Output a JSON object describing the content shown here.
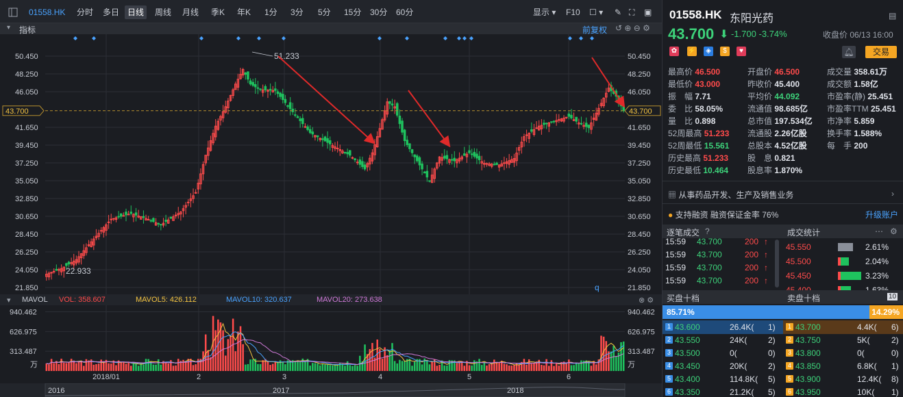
{
  "toolbar": {
    "code": "01558.HK",
    "periods": [
      "分时",
      "多日",
      "日线",
      "周线",
      "月线",
      "季K",
      "年K",
      "1分",
      "3分",
      "5分",
      "15分",
      "30分",
      "60分"
    ],
    "active_period": "日线",
    "display_label": "显示",
    "f10_label": "F10"
  },
  "indicator_bar": {
    "label": "指标",
    "adjust_label": "前复权"
  },
  "chart_data": {
    "type": "candlestick",
    "y_axis_ticks": [
      "50.450",
      "48.250",
      "46.050",
      "43.700",
      "41.650",
      "39.450",
      "37.250",
      "35.050",
      "32.850",
      "30.650",
      "28.450",
      "26.250",
      "24.050",
      "21.850"
    ],
    "ylim": [
      21.85,
      50.45
    ],
    "current_price_label": "43.700",
    "annotations": {
      "high": "51.233",
      "low": "22.933",
      "marker": "q"
    },
    "x_ticks": [
      "2018/01",
      "2",
      "3",
      "4",
      "5",
      "2018",
      "6"
    ],
    "nav_ticks": [
      "2016",
      "2017",
      "2018"
    ],
    "volume": {
      "title": "MAVOL",
      "vol_label": "VOL: 358.607",
      "ma5_label": "MAVOL5: 426.112",
      "ma10_label": "MAVOL10: 320.637",
      "ma20_label": "MAVOL20: 273.638",
      "y_ticks": [
        "940.462",
        "626.975",
        "313.487",
        "万"
      ],
      "ylim": [
        0,
        1000
      ]
    },
    "colors": {
      "up": "#ff4b4b",
      "down": "#1fc25e",
      "bg": "#1b1d22",
      "grid": "#2c2f36",
      "price_line": "#b8902e",
      "ma5": "#f5c542",
      "ma10": "#4aa3ff",
      "ma20": "#d07ad9"
    }
  },
  "quote": {
    "code": "01558.HK",
    "name": "东阳光药",
    "price": "43.700",
    "arrow": "⬇",
    "change": "-1.700",
    "change_pct": "-3.74%",
    "close_time": "收盘价 06/13 16:00",
    "trade_label": "交易"
  },
  "stats": [
    [
      {
        "k": "最高价",
        "v": "46.500",
        "c": "red"
      },
      {
        "k": "开盘价",
        "v": "46.500",
        "c": "red"
      },
      {
        "k": "成交量",
        "v": "358.61万",
        "c": ""
      }
    ],
    [
      {
        "k": "最低价",
        "v": "43.000",
        "c": "red"
      },
      {
        "k": "昨收价",
        "v": "45.400",
        "c": ""
      },
      {
        "k": "成交额",
        "v": "1.58亿",
        "c": ""
      }
    ],
    [
      {
        "k": "振　幅",
        "v": "7.71",
        "c": ""
      },
      {
        "k": "平均价",
        "v": "44.092",
        "c": "grn"
      },
      {
        "k": "市盈率(静)",
        "v": "25.451",
        "c": ""
      }
    ],
    [
      {
        "k": "委　比",
        "v": "58.05%",
        "c": ""
      },
      {
        "k": "流通值",
        "v": "98.685亿",
        "c": ""
      },
      {
        "k": "市盈率TTM",
        "v": "25.451",
        "c": ""
      }
    ],
    [
      {
        "k": "量　比",
        "v": "0.898",
        "c": ""
      },
      {
        "k": "总市值",
        "v": "197.534亿",
        "c": ""
      },
      {
        "k": "市净率",
        "v": "5.859",
        "c": ""
      }
    ],
    [
      {
        "k": "52周最高",
        "v": "51.233",
        "c": "red"
      },
      {
        "k": "流通股",
        "v": "2.26亿股",
        "c": ""
      },
      {
        "k": "换手率",
        "v": "1.588%",
        "c": ""
      }
    ],
    [
      {
        "k": "52周最低",
        "v": "15.561",
        "c": "grn"
      },
      {
        "k": "总股本",
        "v": "4.52亿股",
        "c": ""
      },
      {
        "k": "每　手",
        "v": "200",
        "c": ""
      }
    ],
    [
      {
        "k": "历史最高",
        "v": "51.233",
        "c": "red"
      },
      {
        "k": "股　息",
        "v": "0.821",
        "c": ""
      },
      {
        "k": "",
        "v": "",
        "c": ""
      }
    ],
    [
      {
        "k": "历史最低",
        "v": "10.464",
        "c": "grn"
      },
      {
        "k": "股息率",
        "v": "1.870%",
        "c": ""
      },
      {
        "k": "",
        "v": "",
        "c": ""
      }
    ]
  ],
  "business": "从事药品开发、生产及销售业务",
  "margin": {
    "text": "支持融资  融资保证金率 76%",
    "upgrade": "升级账户"
  },
  "ticks_header": {
    "left": "逐笔成交",
    "right": "成交统计"
  },
  "ticks": [
    {
      "time": "15:59",
      "price": "43.700",
      "qty": "200"
    },
    {
      "time": "15:59",
      "price": "43.700",
      "qty": "200"
    },
    {
      "time": "15:59",
      "price": "43.700",
      "qty": "200"
    },
    {
      "time": "15:59",
      "price": "43.700",
      "qty": "200"
    }
  ],
  "trade_stats": [
    {
      "price": "45.550",
      "pct": "2.61%",
      "gray": 0.7,
      "green": 0
    },
    {
      "price": "45.500",
      "pct": "2.04%",
      "gray": 0,
      "green": 0.4
    },
    {
      "price": "45.450",
      "pct": "3.23%",
      "gray": 0,
      "green": 1.0
    },
    {
      "price": "45.400",
      "pct": "1.63%",
      "gray": 0,
      "green": 0.5
    }
  ],
  "book_header": {
    "bid": "买盘十档",
    "ask": "卖盘十档",
    "count": "10"
  },
  "book_ratio": {
    "bid": "85.71%",
    "ask": "14.29%",
    "bid_frac": 0.8571
  },
  "bids": [
    {
      "n": "1",
      "price": "43.600",
      "vol": "26.4K",
      "cnt": "1"
    },
    {
      "n": "2",
      "price": "43.550",
      "vol": "24K",
      "cnt": "2"
    },
    {
      "n": "3",
      "price": "43.500",
      "vol": "0",
      "cnt": "0"
    },
    {
      "n": "4",
      "price": "43.450",
      "vol": "20K",
      "cnt": "2"
    },
    {
      "n": "5",
      "price": "43.400",
      "vol": "114.8K",
      "cnt": "5"
    },
    {
      "n": "6",
      "price": "43.350",
      "vol": "21.2K",
      "cnt": "5"
    }
  ],
  "asks": [
    {
      "n": "1",
      "price": "43.700",
      "vol": "4.4K",
      "cnt": "6"
    },
    {
      "n": "2",
      "price": "43.750",
      "vol": "5K",
      "cnt": "2"
    },
    {
      "n": "3",
      "price": "43.800",
      "vol": "0",
      "cnt": "0"
    },
    {
      "n": "4",
      "price": "43.850",
      "vol": "6.8K",
      "cnt": "1"
    },
    {
      "n": "5",
      "price": "43.900",
      "vol": "12.4K",
      "cnt": "8"
    },
    {
      "n": "6",
      "price": "43.950",
      "vol": "10K",
      "cnt": "1"
    }
  ]
}
